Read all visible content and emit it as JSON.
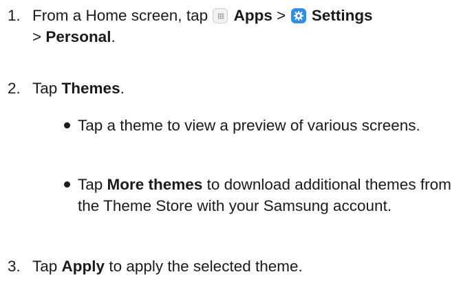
{
  "steps": [
    {
      "number": "1.",
      "text_pre": "From a Home screen, tap",
      "apps_label": "Apps",
      "sep1": ">",
      "settings_label": "Settings",
      "sep2": ">",
      "personal_label": "Personal",
      "period": "."
    },
    {
      "number": "2.",
      "text_pre": "Tap",
      "themes_label": "Themes",
      "period": "."
    },
    {
      "number": "3.",
      "text_pre": "Tap",
      "apply_label": "Apply",
      "text_post": "to apply the selected theme."
    }
  ],
  "bullets": [
    {
      "text": "Tap a theme to view a preview of various screens."
    },
    {
      "text_pre": "Tap",
      "more_themes_label": "More themes",
      "text_post": "to download additional themes from the Theme Store with your Samsung account."
    }
  ],
  "icons": {
    "apps": "apps-grid-icon",
    "settings": "settings-gear-icon"
  },
  "colors": {
    "settings_icon_bg": "#2f8fe8",
    "text": "#1a1a1a"
  }
}
